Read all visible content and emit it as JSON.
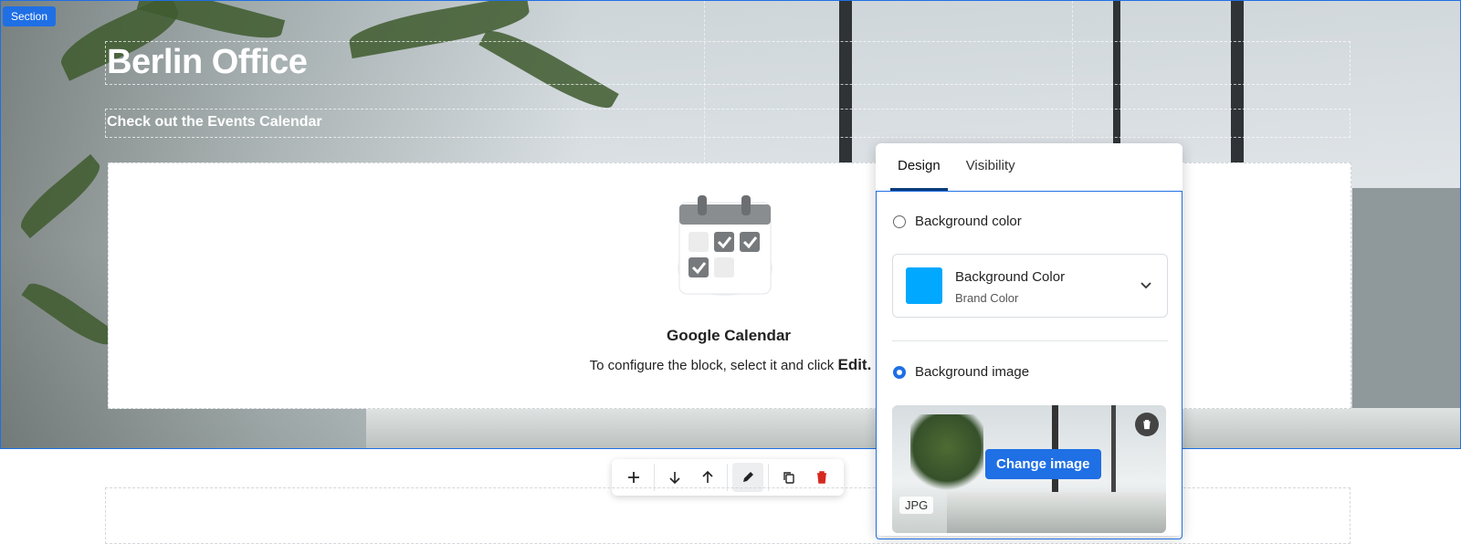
{
  "section": {
    "badge": "Section"
  },
  "hero": {
    "title": "Berlin Office",
    "subtitle": "Check out the Events Calendar"
  },
  "calendar_block": {
    "title": "Google Calendar",
    "instruction": "To configure the block, select it and click",
    "action_word": "Edit."
  },
  "toolbar": {
    "items": [
      {
        "name": "add-block-button",
        "icon": "plus-icon"
      },
      {
        "name": "move-down-button",
        "icon": "arrow-down-icon"
      },
      {
        "name": "move-up-button",
        "icon": "arrow-up-icon"
      },
      {
        "name": "edit-button",
        "icon": "pencil-icon",
        "active": true
      },
      {
        "name": "duplicate-button",
        "icon": "copy-icon"
      },
      {
        "name": "delete-button",
        "icon": "trash-icon"
      }
    ]
  },
  "design_panel": {
    "tabs": [
      {
        "label": "Design",
        "active": true
      },
      {
        "label": "Visibility",
        "active": false
      }
    ],
    "background_color_option": {
      "label": "Background color",
      "selected": false
    },
    "color_card": {
      "title": "Background Color",
      "subtitle": "Brand Color",
      "swatch": "#00a8ff"
    },
    "background_image_option": {
      "label": "Background image",
      "selected": true
    },
    "image": {
      "change_label": "Change image",
      "format_badge": "JPG"
    }
  },
  "colors": {
    "accent": "#1f6fe5",
    "delete_red": "#d6291f",
    "swatch": "#00a8ff"
  }
}
